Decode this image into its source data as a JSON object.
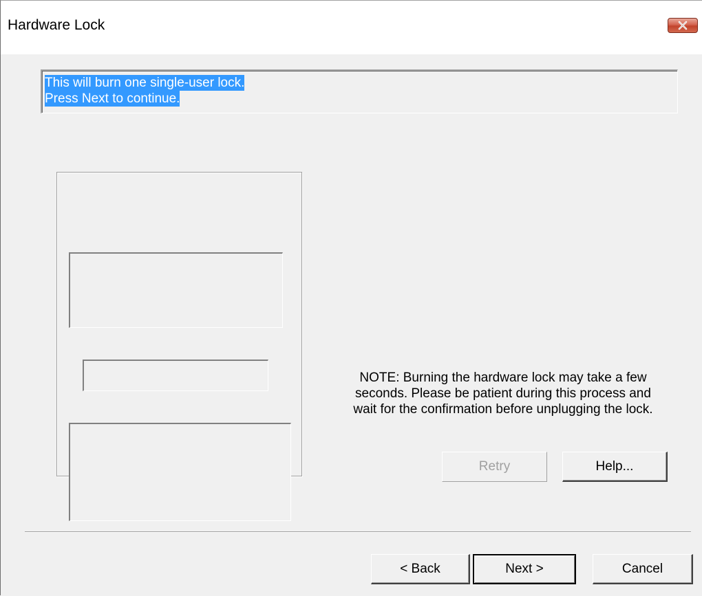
{
  "window": {
    "title": "Hardware Lock",
    "close_icon": "close-icon"
  },
  "header": {
    "line1": "This will burn one single-user lock.",
    "line2": "Press Next to continue."
  },
  "note": {
    "line1": "NOTE: Burning the hardware lock may take a few",
    "line2": "seconds. Please be patient during this process and",
    "line3": "wait for the confirmation before unplugging the lock."
  },
  "buttons": {
    "retry": "Retry",
    "help": "Help...",
    "back": "< Back",
    "next": "Next >",
    "cancel": "Cancel"
  },
  "colors": {
    "selection": "#3399ff",
    "close_button": "#c2432b",
    "dialog_bg": "#f0f0f0"
  }
}
